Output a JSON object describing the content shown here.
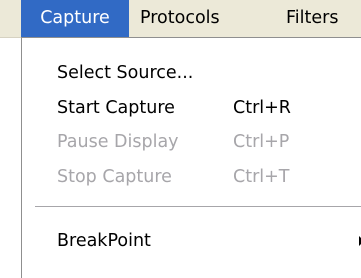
{
  "menubar": {
    "items": [
      {
        "label": "Capture",
        "active": true
      },
      {
        "label": "Protocols",
        "active": false
      },
      {
        "label": "Filters",
        "active": false
      }
    ],
    "active_color": "#316ac5"
  },
  "capture_menu": {
    "items": [
      {
        "label": "Select Source...",
        "shortcut": "",
        "enabled": true
      },
      {
        "label": "Start Capture",
        "shortcut": "Ctrl+R",
        "enabled": true
      },
      {
        "label": "Pause Display",
        "shortcut": "Ctrl+P",
        "enabled": false
      },
      {
        "label": "Stop Capture",
        "shortcut": "Ctrl+T",
        "enabled": false
      },
      {
        "label": "BreakPoint",
        "shortcut": "",
        "enabled": true,
        "submenu": true,
        "icon": "submenu-arrow-icon"
      }
    ],
    "disabled_color": "#a7a6aa"
  }
}
